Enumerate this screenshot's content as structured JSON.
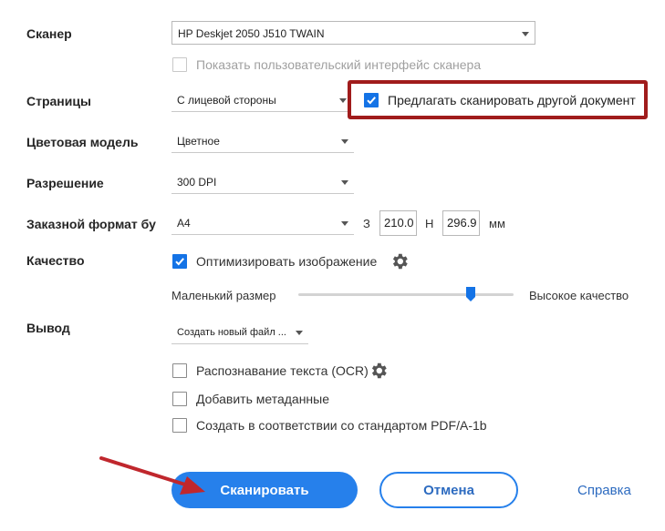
{
  "scanner": {
    "label": "Сканер",
    "value": "HP Deskjet 2050 J510 TWAIN",
    "show_ui_label": "Показать пользовательский интерфейс сканера",
    "show_ui_checked": false
  },
  "pages": {
    "label": "Страницы",
    "value": "С лицевой стороны",
    "prompt_label": "Предлагать сканировать другой документ",
    "prompt_checked": true
  },
  "color_model": {
    "label": "Цветовая модель",
    "value": "Цветное"
  },
  "resolution": {
    "label": "Разрешение",
    "value": "300 DPI"
  },
  "custom_size": {
    "label": "Заказной формат бу",
    "value": "A4",
    "width_prefix": "З",
    "width": "210.0",
    "height_prefix": "Н",
    "height": "296.9",
    "unit": "мм"
  },
  "quality": {
    "label": "Качество",
    "optimize_label": "Оптимизировать изображение",
    "optimize_checked": true,
    "slider_min_label": "Маленький размер",
    "slider_max_label": "Высокое качество",
    "slider_value": 0.8
  },
  "output": {
    "label": "Вывод",
    "value": "Создать новый файл ...",
    "ocr_label": "Распознавание текста (OCR)",
    "ocr_checked": false,
    "metadata_label": "Добавить метаданные",
    "metadata_checked": false,
    "pdfa_label": "Создать в соответствии со стандартом PDF/A-1b",
    "pdfa_checked": false
  },
  "actions": {
    "scan_label": "Сканировать",
    "cancel_label": "Отмена",
    "help_label": "Справка"
  },
  "colors": {
    "accent": "#2680eb",
    "highlight_border": "#a01c1c",
    "arrow": "#c0272d"
  }
}
